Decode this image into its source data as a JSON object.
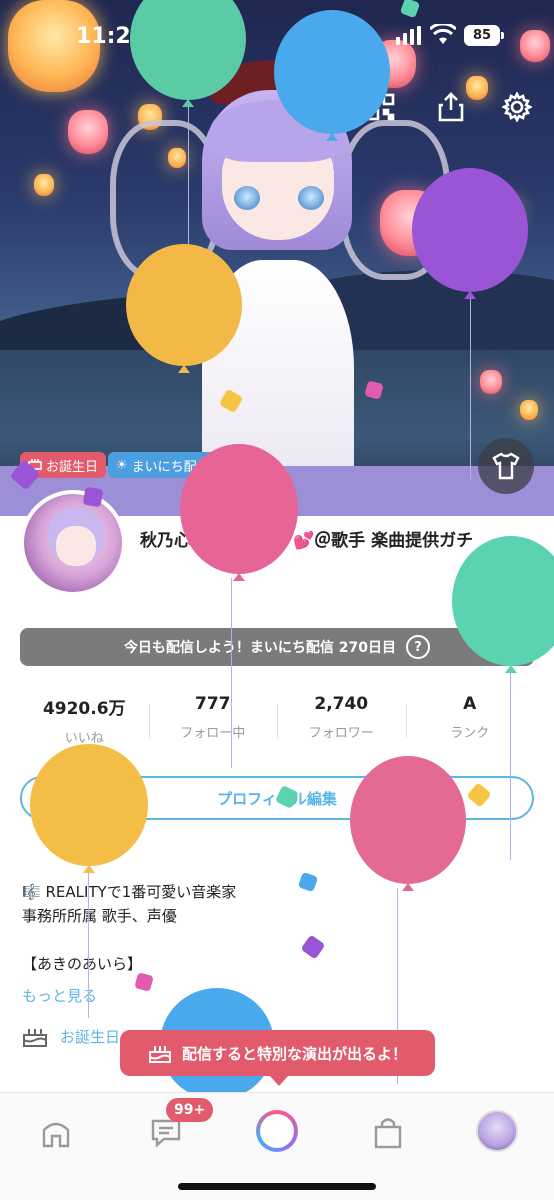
{
  "status_bar": {
    "time": "11:28",
    "battery": "85"
  },
  "hero": {
    "tags": {
      "birthday": "お誕生日",
      "daily": "まいにち配信"
    }
  },
  "profile": {
    "username": "秋乃心　　　　　　💕＠歌手 楽曲提供ガチ",
    "streak_text": "今日も配信しよう！まいにち配信 270日目",
    "stats": [
      {
        "value": "4920.6万",
        "label": "いいね"
      },
      {
        "value": "777",
        "label": "フォロー中"
      },
      {
        "value": "2,740",
        "label": "フォロワー"
      },
      {
        "value": "A",
        "label": "ランク"
      }
    ],
    "edit_button": "プロフィール編集",
    "bio_lines": [
      "🎼 REALITYで1番可愛い音楽家",
      "事務所所属 歌手、声優",
      "",
      "【あきのあいら】"
    ],
    "more_link": "もっと見る",
    "birthday_label": "お誕生日"
  },
  "toast": {
    "text": "配信すると特別な演出が出るよ！"
  },
  "tabbar": {
    "notifications_badge": "99+"
  },
  "colors": {
    "accent_blue": "#5bb6e6",
    "accent_pink": "#e25b6c",
    "streak_gray": "#7b7b7b"
  }
}
